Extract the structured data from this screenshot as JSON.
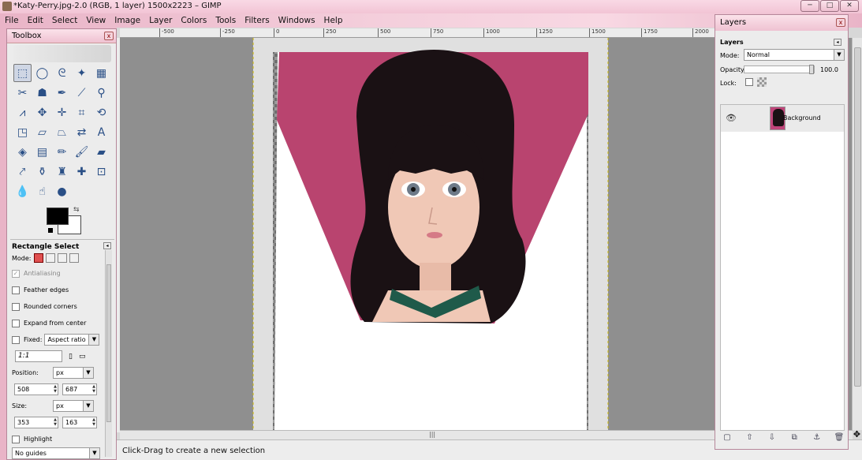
{
  "window": {
    "title": "*Katy-Perry.jpg-2.0 (RGB, 1 layer) 1500x2223 – GIMP",
    "btn_min": "─",
    "btn_max": "□",
    "btn_close": "✕"
  },
  "menu": [
    "File",
    "Edit",
    "Select",
    "View",
    "Image",
    "Layer",
    "Colors",
    "Tools",
    "Filters",
    "Windows",
    "Help"
  ],
  "ruler": {
    "ticks": [
      "-500",
      "-250",
      "0",
      "250",
      "500",
      "750",
      "1000",
      "1250",
      "1500",
      "1750",
      "2000"
    ]
  },
  "status": {
    "message": "Click-Drag to create a new selection"
  },
  "toolbox": {
    "title": "Toolbox",
    "close_label": "x",
    "tools": [
      {
        "name": "rect-select-icon",
        "glyph": "⬚"
      },
      {
        "name": "ellipse-select-icon",
        "glyph": "◯"
      },
      {
        "name": "free-select-icon",
        "glyph": "ᘓ"
      },
      {
        "name": "fuzzy-select-icon",
        "glyph": "✦"
      },
      {
        "name": "select-by-color-icon",
        "glyph": "▦"
      },
      {
        "name": "scissors-select-icon",
        "glyph": "✂"
      },
      {
        "name": "foreground-select-icon",
        "glyph": "☗"
      },
      {
        "name": "paths-icon",
        "glyph": "✒"
      },
      {
        "name": "color-picker-icon",
        "glyph": "⟋"
      },
      {
        "name": "zoom-icon",
        "glyph": "⚲"
      },
      {
        "name": "measure-icon",
        "glyph": "⩘"
      },
      {
        "name": "move-icon",
        "glyph": "✥"
      },
      {
        "name": "align-icon",
        "glyph": "✛"
      },
      {
        "name": "crop-icon",
        "glyph": "⌗"
      },
      {
        "name": "rotate-icon",
        "glyph": "⟲"
      },
      {
        "name": "scale-icon",
        "glyph": "◳"
      },
      {
        "name": "shear-icon",
        "glyph": "▱"
      },
      {
        "name": "perspective-icon",
        "glyph": "⏢"
      },
      {
        "name": "flip-icon",
        "glyph": "⇄"
      },
      {
        "name": "text-icon",
        "glyph": "A"
      },
      {
        "name": "bucket-fill-icon",
        "glyph": "◈"
      },
      {
        "name": "blend-icon",
        "glyph": "▤"
      },
      {
        "name": "pencil-icon",
        "glyph": "✏"
      },
      {
        "name": "paintbrush-icon",
        "glyph": "🖌"
      },
      {
        "name": "eraser-icon",
        "glyph": "▰"
      },
      {
        "name": "airbrush-icon",
        "glyph": "⤤"
      },
      {
        "name": "ink-icon",
        "glyph": "⚱"
      },
      {
        "name": "clone-icon",
        "glyph": "♜"
      },
      {
        "name": "heal-icon",
        "glyph": "✚"
      },
      {
        "name": "perspective-clone-icon",
        "glyph": "⊡"
      },
      {
        "name": "blur-icon",
        "glyph": "💧"
      },
      {
        "name": "smudge-icon",
        "glyph": "☝"
      },
      {
        "name": "dodge-burn-icon",
        "glyph": "●"
      }
    ],
    "options": {
      "title": "Rectangle Select",
      "mode_label": "Mode:",
      "antialiasing": "Antialiasing",
      "check_mark": "✓",
      "feather": "Feather edges",
      "rounded": "Rounded corners",
      "expand": "Expand from center",
      "fixed": "Fixed:",
      "fixed_value": "Aspect ratio",
      "ratio": "1:1",
      "position_label": "Position:",
      "position_unit": "px",
      "position_x": "508",
      "position_y": "687",
      "size_label": "Size:",
      "size_unit": "px",
      "size_w": "353",
      "size_h": "163",
      "highlight": "Highlight",
      "guides": "No guides"
    }
  },
  "layers": {
    "title": "Layers",
    "close_label": "x",
    "sub_title": "Layers",
    "mode_label": "Mode:",
    "mode_value": "Normal",
    "opacity_label": "Opacity:",
    "opacity_value": "100.0",
    "lock_label": "Lock:",
    "layer_name": "Background"
  }
}
